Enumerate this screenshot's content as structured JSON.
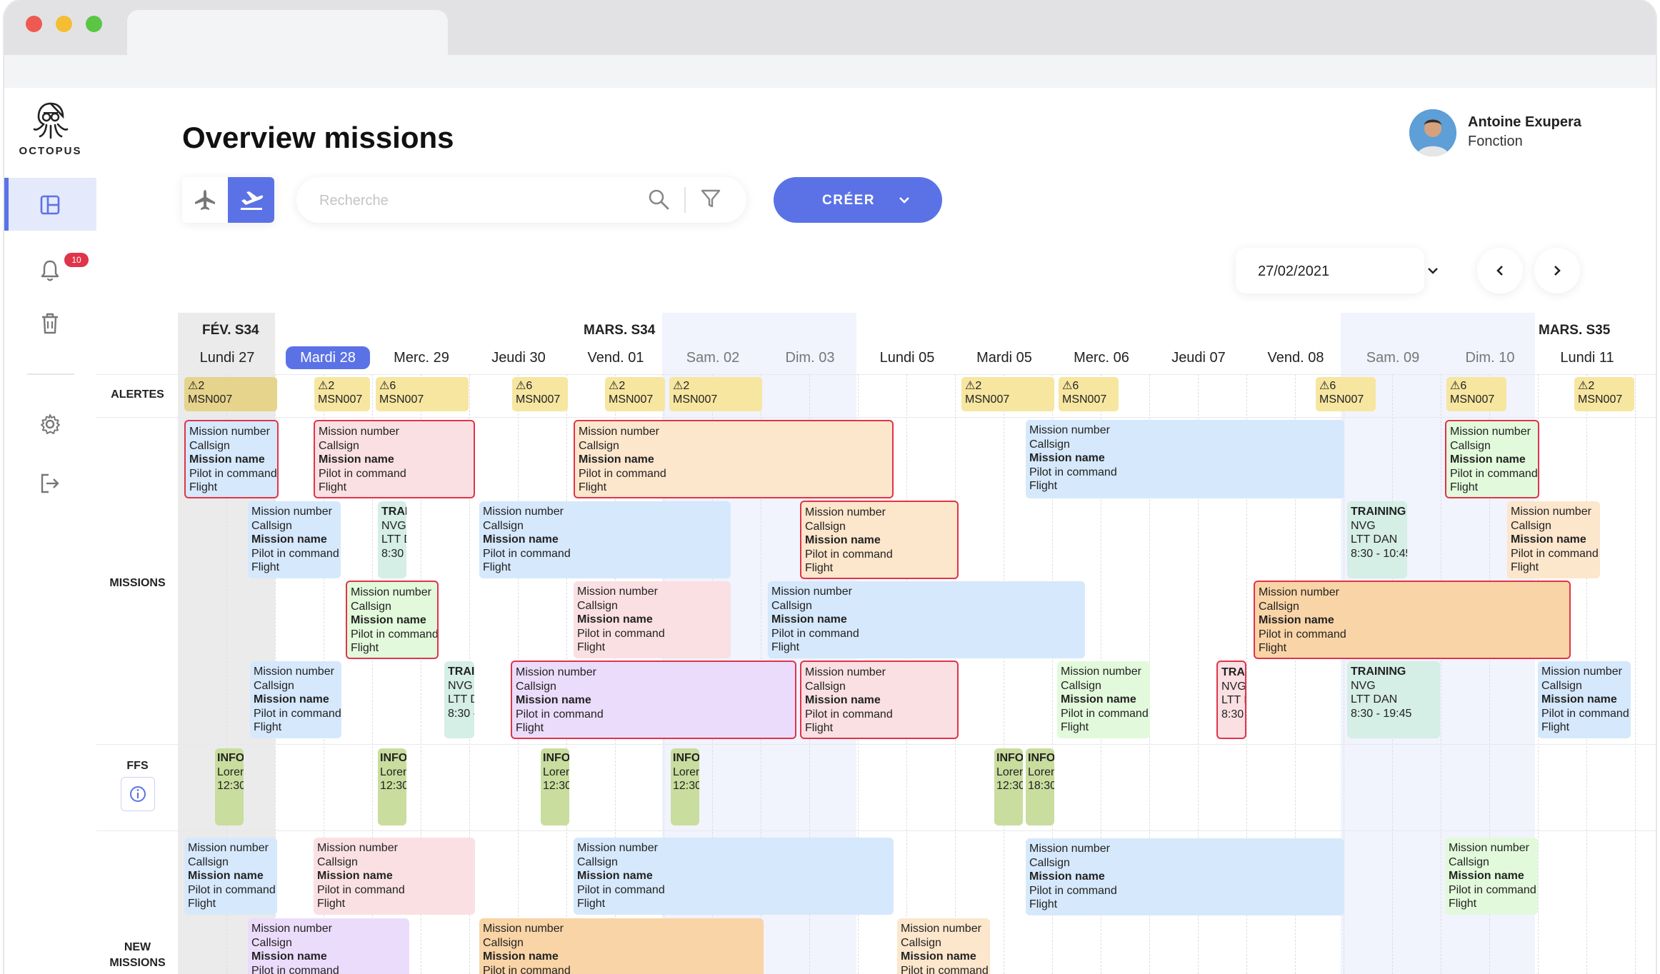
{
  "app": {
    "logo_text": "OCTOPUS",
    "notification_count": "10"
  },
  "header": {
    "title": "Overview missions",
    "search_placeholder": "Recherche",
    "create_label": "CRÉER",
    "date_value": "27/02/2021"
  },
  "user": {
    "name": "Antoine Exupera",
    "role": "Fonction"
  },
  "weeks": [
    "FÉV. S34",
    "MARS. S34",
    "MARS. S35"
  ],
  "days": [
    "Lundi 27",
    "Mardi 28",
    "Merc. 29",
    "Jeudi 30",
    "Vend. 01",
    "Sam. 02",
    "Dim. 03",
    "Lundi 05",
    "Mardi 05",
    "Merc. 06",
    "Jeudi 07",
    "Vend. 08",
    "Sam. 09",
    "Dim. 10",
    "Lundi 11"
  ],
  "rows": {
    "alerts": "ALERTES",
    "missions": "MISSIONS",
    "ffs": "FFS",
    "new_missions_1": "NEW",
    "new_missions_2": "MISSIONS"
  },
  "alert": {
    "count_a": "⚠2",
    "count_b": "⚠6",
    "code": "MSN007"
  },
  "card": {
    "number": "Mission number",
    "callsign": "Callsign",
    "name": "Mission name",
    "pilot": "Pilot in command",
    "flight": "Flight"
  },
  "training": {
    "title": "TRAINING",
    "title_short": "TRAI",
    "nvg": "NVG",
    "ltt": "LTT DAN",
    "ltt_short": "LTT D",
    "time1": "8:30 - 10:45",
    "time2": "8:30 - 19:45",
    "time_short": "8:30 -"
  },
  "info": {
    "title": "INFO",
    "lorem": "Loren",
    "time1": "12:30",
    "time2": "18:30"
  },
  "colors": {
    "accent": "#5b72e6",
    "alert": "#f6e6a0",
    "selected_border": "#e0344a",
    "blue": "#d6e8fb",
    "pink": "#fae0e3",
    "peach": "#fce6cc",
    "green": "#e2fadb",
    "purple": "#ecdcfb",
    "orange": "#f9d4a6",
    "info": "#c9dd9e"
  }
}
